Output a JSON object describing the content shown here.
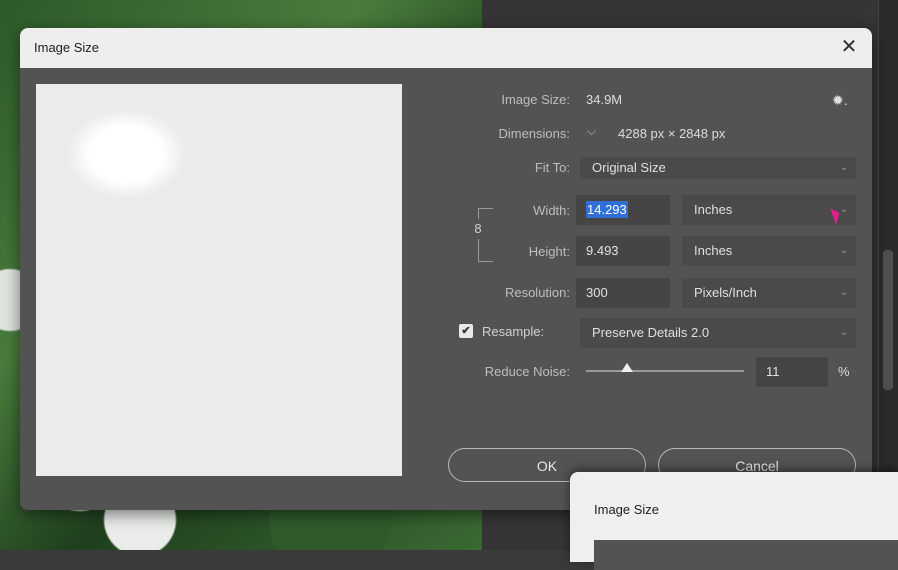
{
  "dialog": {
    "title": "Image Size",
    "close_symbol": "✕",
    "image_size_label": "Image Size:",
    "image_size_value": "34.9M",
    "settings_icon": "gear-icon",
    "settings_symbol": "✹.",
    "dimensions_label": "Dimensions:",
    "dimensions_chevron": "⌵",
    "dimensions_value": "4288 px  ×  2848 px",
    "fit_to_label": "Fit To:",
    "fit_to_value": "Original Size",
    "width_label": "Width:",
    "width_value": "14.293",
    "width_unit": "Inches",
    "height_label": "Height:",
    "height_value": "9.493",
    "height_unit": "Inches",
    "resolution_label": "Resolution:",
    "resolution_value": "300",
    "resolution_unit": "Pixels/Inch",
    "resample_label": "Resample:",
    "resample_checked": true,
    "resample_checkmark": "✔",
    "resample_value": "Preserve Details 2.0",
    "reduce_noise_label": "Reduce Noise:",
    "reduce_noise_value": "11",
    "reduce_noise_unit": "%",
    "reduce_noise_level_percent": 11,
    "ok_label": "OK",
    "cancel_label": "Cancel",
    "chevron": "⌄",
    "link_symbol": "8"
  },
  "second_dialog": {
    "title": "Image Size"
  },
  "colors": {
    "dialog_bg": "#535353",
    "selection": "#2f6fd6",
    "cursor": "#e61e8c"
  }
}
